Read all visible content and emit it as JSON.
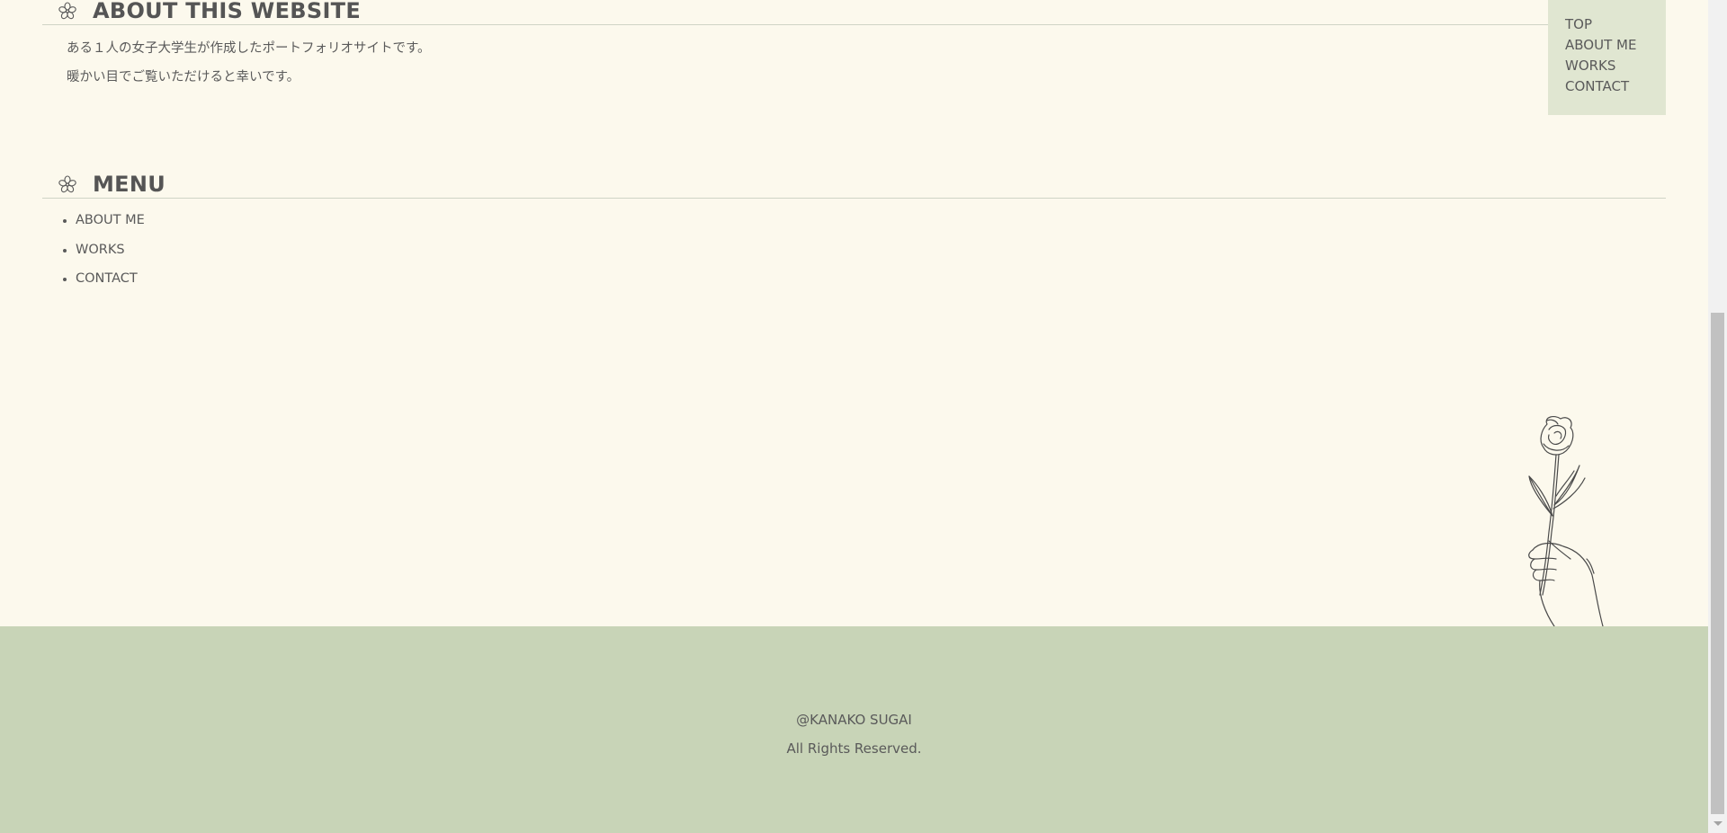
{
  "about_section": {
    "heading": "ABOUT THIS WEBSITE",
    "lines": [
      "ある１人の女子大学生が作成したポートフォリオサイトです。",
      "暖かい目でご覧いただけると幸いです。"
    ]
  },
  "menu_section": {
    "heading": "MENU",
    "items": [
      "ABOUT ME",
      "WORKS",
      "CONTACT"
    ]
  },
  "floating_nav": {
    "items": [
      "TOP",
      "ABOUT ME",
      "WORKS",
      "CONTACT"
    ]
  },
  "footer": {
    "copyright": "@KANAKO SUGAI",
    "rights": "All Rights Reserved."
  },
  "colors": {
    "background": "#fcf9ed",
    "footer_bg": "#c8d4b7",
    "nav_bg": "#e0e6d1",
    "text": "#5a5a5a"
  },
  "icons": {
    "heading_icon": "flower-icon",
    "illustration": "rose-in-hand-illustration"
  }
}
